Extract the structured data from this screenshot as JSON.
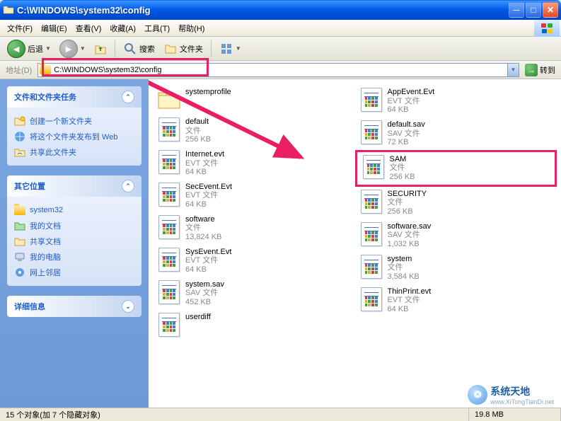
{
  "window": {
    "title": "C:\\WINDOWS\\system32\\config"
  },
  "menu": {
    "file": "文件(F)",
    "edit": "编辑(E)",
    "view": "查看(V)",
    "favorites": "收藏(A)",
    "tools": "工具(T)",
    "help": "帮助(H)"
  },
  "toolbar": {
    "back": "后退",
    "search": "搜索",
    "folders": "文件夹"
  },
  "address": {
    "label": "地址(D)",
    "path": "C:\\WINDOWS\\system32\\config",
    "go": "转到"
  },
  "sidebar": {
    "tasks": {
      "title": "文件和文件夹任务",
      "items": [
        {
          "label": "创建一个新文件夹",
          "icon": "new-folder"
        },
        {
          "label": "将这个文件夹发布到 Web",
          "icon": "publish-web"
        },
        {
          "label": "共享此文件夹",
          "icon": "share-folder"
        }
      ]
    },
    "other": {
      "title": "其它位置",
      "items": [
        {
          "label": "system32",
          "icon": "folder"
        },
        {
          "label": "我的文档",
          "icon": "my-docs"
        },
        {
          "label": "共享文档",
          "icon": "shared-docs"
        },
        {
          "label": "我的电脑",
          "icon": "my-computer"
        },
        {
          "label": "网上邻居",
          "icon": "network"
        }
      ]
    },
    "details": {
      "title": "详细信息"
    }
  },
  "files": {
    "left": [
      {
        "name": "systemprofile",
        "type": "",
        "size": "",
        "kind": "folder"
      },
      {
        "name": "default",
        "type": "文件",
        "size": "256 KB",
        "kind": "file"
      },
      {
        "name": "Internet.evt",
        "type": "EVT 文件",
        "size": "64 KB",
        "kind": "file"
      },
      {
        "name": "SecEvent.Evt",
        "type": "EVT 文件",
        "size": "64 KB",
        "kind": "file"
      },
      {
        "name": "software",
        "type": "文件",
        "size": "13,824 KB",
        "kind": "file"
      },
      {
        "name": "SysEvent.Evt",
        "type": "EVT 文件",
        "size": "64 KB",
        "kind": "file"
      },
      {
        "name": "system.sav",
        "type": "SAV 文件",
        "size": "452 KB",
        "kind": "file"
      },
      {
        "name": "userdiff",
        "type": "",
        "size": "",
        "kind": "file"
      }
    ],
    "right": [
      {
        "name": "AppEvent.Evt",
        "type": "EVT 文件",
        "size": "64 KB",
        "kind": "file"
      },
      {
        "name": "default.sav",
        "type": "SAV 文件",
        "size": "72 KB",
        "kind": "file"
      },
      {
        "name": "SAM",
        "type": "文件",
        "size": "256 KB",
        "kind": "file",
        "highlight": true
      },
      {
        "name": "SECURITY",
        "type": "文件",
        "size": "256 KB",
        "kind": "file"
      },
      {
        "name": "software.sav",
        "type": "SAV 文件",
        "size": "1,032 KB",
        "kind": "file"
      },
      {
        "name": "system",
        "type": "文件",
        "size": "3,584 KB",
        "kind": "file"
      },
      {
        "name": "ThinPrint.evt",
        "type": "EVT 文件",
        "size": "64 KB",
        "kind": "file"
      }
    ]
  },
  "status": {
    "text": "15 个对象(加 7 个隐藏对象)",
    "size": "19.8 MB"
  },
  "watermark": {
    "text": "系统天地",
    "url": "www.XiTongTianDi.net"
  }
}
